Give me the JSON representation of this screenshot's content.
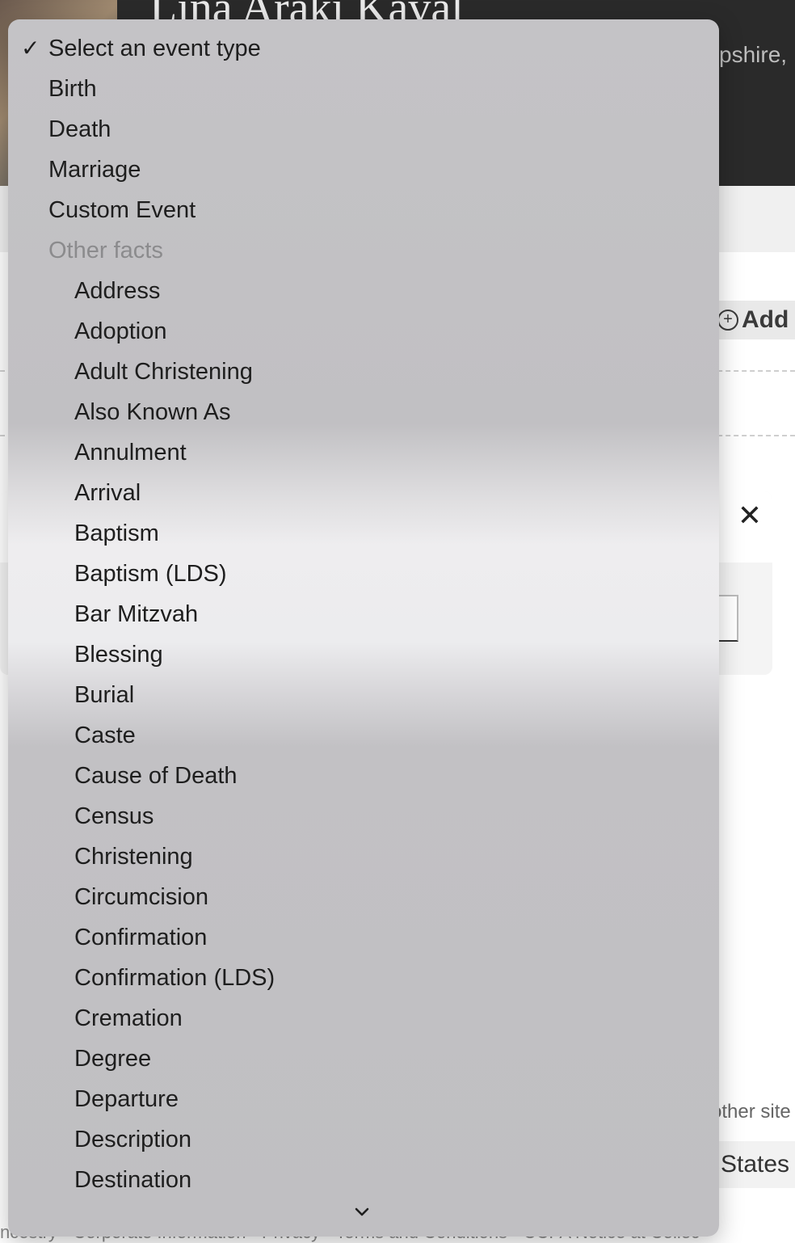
{
  "background": {
    "person_name": "Lina Araki Kaval",
    "place_partial": "pshire,",
    "add_label": "Add",
    "footer_link_partial": "other site",
    "footer_country": "States",
    "footer_text": "ncestry · Corporate Information · Privacy · Terms and Conditions · CCPA Notice at Collec"
  },
  "dropdown": {
    "selected": "Select an event type",
    "options": [
      "Birth",
      "Death",
      "Marriage",
      "Custom Event"
    ],
    "group_label": "Other facts",
    "group_options": [
      "Address",
      "Adoption",
      "Adult Christening",
      "Also Known As",
      "Annulment",
      "Arrival",
      "Baptism",
      "Baptism (LDS)",
      "Bar Mitzvah",
      "Blessing",
      "Burial",
      "Caste",
      "Cause of Death",
      "Census",
      "Christening",
      "Circumcision",
      "Confirmation",
      "Confirmation (LDS)",
      "Cremation",
      "Degree",
      "Departure",
      "Description",
      "Destination"
    ]
  },
  "icons": {
    "check": "checkmark-icon",
    "scroll": "chevron-down-icon",
    "close": "close-icon"
  }
}
